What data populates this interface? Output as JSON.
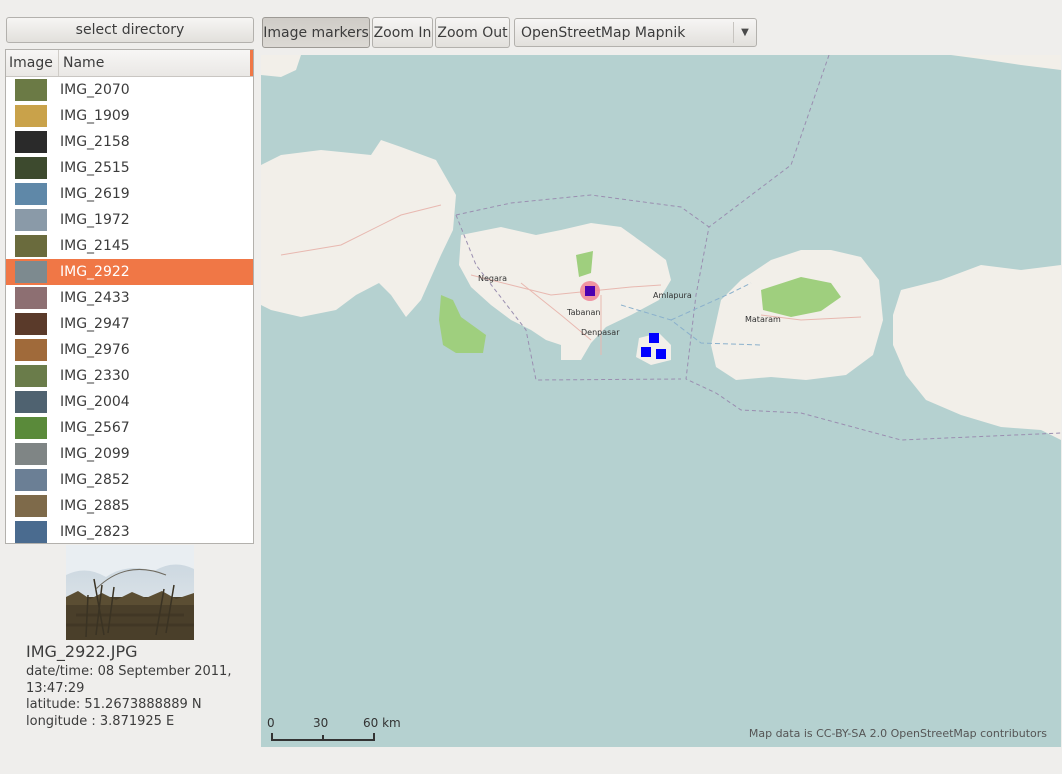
{
  "toolbar": {
    "select_directory": "select directory",
    "image_markers": "Image markers",
    "zoom_in": "Zoom In",
    "zoom_out": "Zoom Out",
    "map_source": "OpenStreetMap Mapnik"
  },
  "list": {
    "col_image": "Image",
    "col_name": "Name",
    "rows": [
      {
        "name": "IMG_2070",
        "thumb": "#6b7a45"
      },
      {
        "name": "IMG_1909",
        "thumb": "#c9a24a"
      },
      {
        "name": "IMG_2158",
        "thumb": "#2a2a2a"
      },
      {
        "name": "IMG_2515",
        "thumb": "#3d4a2e"
      },
      {
        "name": "IMG_2619",
        "thumb": "#5f88a8"
      },
      {
        "name": "IMG_1972",
        "thumb": "#8a9aa8"
      },
      {
        "name": "IMG_2145",
        "thumb": "#6a6b3d"
      },
      {
        "name": "IMG_2922",
        "thumb": "#7d8a8f"
      },
      {
        "name": "IMG_2433",
        "thumb": "#8d6f72"
      },
      {
        "name": "IMG_2947",
        "thumb": "#5a3a2a"
      },
      {
        "name": "IMG_2976",
        "thumb": "#a06a3a"
      },
      {
        "name": "IMG_2330",
        "thumb": "#6a7c4a"
      },
      {
        "name": "IMG_2004",
        "thumb": "#4f6270"
      },
      {
        "name": "IMG_2567",
        "thumb": "#5a8a3a"
      },
      {
        "name": "IMG_2099",
        "thumb": "#7f8585"
      },
      {
        "name": "IMG_2852",
        "thumb": "#6b7f95"
      },
      {
        "name": "IMG_2885",
        "thumb": "#7e6a4a"
      },
      {
        "name": "IMG_2823",
        "thumb": "#4a6b8f"
      }
    ],
    "selected_name": "IMG_2922"
  },
  "info": {
    "filename": "IMG_2922.JPG",
    "datetime": "date/time: 08 September 2011, 13:47:29",
    "latitude": "latitude: 51.2673888889 N",
    "longitude": "longitude : 3.871925 E"
  },
  "map": {
    "towns": [
      "Negara",
      "Tabanan",
      "Denpasar",
      "Amlapura",
      "Mataram"
    ],
    "scale_0": "0",
    "scale_30": "30",
    "scale_60": "60 km",
    "attribution": "Map data is CC-BY-SA 2.0 OpenStreetMap contributors",
    "colors": {
      "sea": "#b5d1d0",
      "land": "#f2efe9",
      "park": "#9fcf7e",
      "marker": "#0000ff",
      "highlight": "#f0899a"
    }
  }
}
